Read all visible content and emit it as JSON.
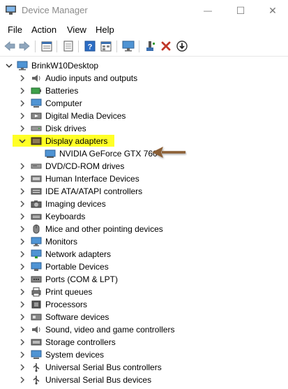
{
  "window": {
    "title": "Device Manager",
    "minimize_glyph": "—",
    "maximize_glyph": "☐",
    "close_glyph": "✕"
  },
  "menu": [
    "File",
    "Action",
    "View",
    "Help"
  ],
  "toolbar": {
    "icons": [
      "back-arrow-icon",
      "forward-arrow-icon",
      "properties-sheet-icon",
      "document-icon",
      "help-icon",
      "show-hidden-icon",
      "monitor-icon",
      "update-driver-icon",
      "uninstall-x-icon",
      "scan-download-icon"
    ]
  },
  "tree": {
    "root": "BrinkW10Desktop",
    "categories": [
      {
        "label": "Audio inputs and outputs",
        "icon": "speaker-icon"
      },
      {
        "label": "Batteries",
        "icon": "battery-icon"
      },
      {
        "label": "Computer",
        "icon": "computer-icon"
      },
      {
        "label": "Digital Media Devices",
        "icon": "media-device-icon"
      },
      {
        "label": "Disk drives",
        "icon": "disk-drive-icon"
      },
      {
        "label": "Display adapters",
        "icon": "display-adapter-icon",
        "expanded": true,
        "children": [
          {
            "label": "NVIDIA GeForce GTX 760",
            "icon": "gpu-icon"
          }
        ]
      },
      {
        "label": "DVD/CD-ROM drives",
        "icon": "dvd-icon"
      },
      {
        "label": "Human Interface Devices",
        "icon": "hid-icon"
      },
      {
        "label": "IDE ATA/ATAPI controllers",
        "icon": "ide-controller-icon"
      },
      {
        "label": "Imaging devices",
        "icon": "camera-icon"
      },
      {
        "label": "Keyboards",
        "icon": "keyboard-icon"
      },
      {
        "label": "Mice and other pointing devices",
        "icon": "mouse-icon"
      },
      {
        "label": "Monitors",
        "icon": "monitor-icon"
      },
      {
        "label": "Network adapters",
        "icon": "network-adapter-icon"
      },
      {
        "label": "Portable Devices",
        "icon": "portable-device-icon"
      },
      {
        "label": "Ports (COM & LPT)",
        "icon": "port-icon"
      },
      {
        "label": "Print queues",
        "icon": "printer-icon"
      },
      {
        "label": "Processors",
        "icon": "processor-icon"
      },
      {
        "label": "Software devices",
        "icon": "software-device-icon"
      },
      {
        "label": "Sound, video and game controllers",
        "icon": "sound-icon"
      },
      {
        "label": "Storage controllers",
        "icon": "storage-controller-icon"
      },
      {
        "label": "System devices",
        "icon": "system-device-icon"
      },
      {
        "label": "Universal Serial Bus controllers",
        "icon": "usb-icon"
      },
      {
        "label": "Universal Serial Bus devices",
        "icon": "usb-icon"
      }
    ]
  },
  "colors": {
    "highlight": "#ffff26",
    "annotation_arrow": "#8b5e34",
    "icon_blue": "#2b7fd8",
    "icon_gray": "#5a5a5a"
  }
}
